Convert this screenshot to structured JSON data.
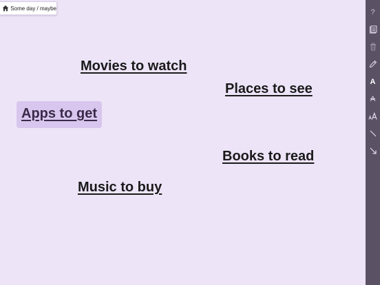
{
  "breadcrumb": {
    "home_icon": "home-icon",
    "label": "Some day / maybe"
  },
  "items": [
    {
      "label": "Movies to watch",
      "selected": false
    },
    {
      "label": "Places to see",
      "selected": false
    },
    {
      "label": "Apps to get",
      "selected": true
    },
    {
      "label": "Books to read",
      "selected": false
    },
    {
      "label": "Music to buy",
      "selected": false
    }
  ],
  "toolbar": {
    "tools": [
      {
        "name": "help-icon",
        "glyph": "?"
      },
      {
        "name": "clipboard-icon"
      },
      {
        "name": "trash-icon"
      },
      {
        "name": "pencil-icon"
      },
      {
        "name": "bold-text-icon",
        "glyph": "A"
      },
      {
        "name": "strikethrough-text-icon",
        "glyph": "A"
      },
      {
        "name": "text-size-icon",
        "glyph": "AA"
      },
      {
        "name": "line-tool-icon"
      },
      {
        "name": "arrow-tool-icon"
      }
    ]
  },
  "colors": {
    "canvas_background": "#ede4f8",
    "toolbar_background": "#5a5165",
    "selection_highlight": "#d8c6ee"
  }
}
